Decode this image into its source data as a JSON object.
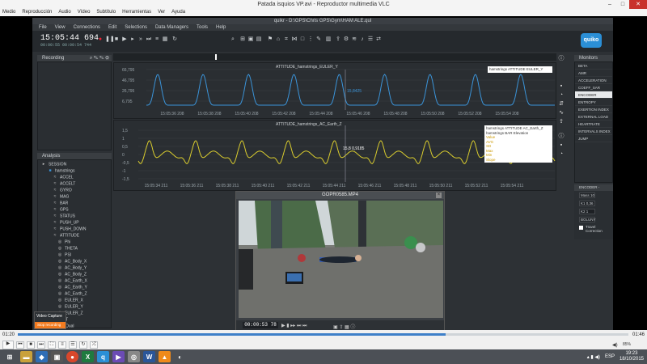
{
  "vlc": {
    "title": "Patada isquios VP.avi - Reproductor multimedia VLC",
    "menu": [
      "Medio",
      "Reproducción",
      "Audio",
      "Vídeo",
      "Subtítulo",
      "Herramientas",
      "Ver",
      "Ayuda"
    ],
    "time_elapsed": "01:20",
    "time_total": "01:46",
    "progress_fraction": 0.7,
    "volume": "85%"
  },
  "taskbar": {
    "clock_time": "19:23",
    "clock_date": "18/10/2015",
    "lang": "ESP"
  },
  "app": {
    "title": "quikr - D:\\GPS\\Chris GPS\\Gym\\HAM ALE.qul",
    "menu": [
      "File",
      "View",
      "Connections",
      "Edit",
      "Selections",
      "Data Managers",
      "Tools",
      "Help"
    ],
    "clock": "15:05:44 694",
    "clock_sub_a": "00:00:55",
    "clock_sub_b": "00:00:54 744",
    "logo": "quiko",
    "recording_label": "Recording",
    "analysis_label": "Analysis",
    "tree": [
      "SESSION",
      "hamstrings",
      "ACCEL",
      "ACCELT",
      "GYRO",
      "MAG",
      "BAR",
      "GPS",
      "STATUS",
      "PUSH_UP",
      "PUSH_DOWN",
      "ATTITUDE",
      "Phi",
      "THETA",
      "PSI",
      "AC_Body_X",
      "AC_Body_Y",
      "AC_Body_Z",
      "AC_Earth_X",
      "AC_Earth_Y",
      "AC_Earth_Z",
      "EULER_X",
      "EULER_Y",
      "EULER_Z",
      "HRT",
      "REQual"
    ],
    "monitors_label": "Monitors",
    "monitors": [
      "BETA",
      "AMR",
      "ACCELERATION",
      "COEFF_SAR",
      "ENCODER",
      "ENTROPY",
      "EXERTION INDEX",
      "EXTERNAL LOAD",
      "HEARTRATE",
      "INTERVALS INDEX",
      "JUMP"
    ],
    "encoder_label": "ENCODER - ATTITUDE_N",
    "encoder_fields": [
      "Mass 10",
      "K1 0,36",
      "K2 1",
      "BOLUNY"
    ],
    "travel_correction": "Travel Correction"
  },
  "chart_data": [
    {
      "type": "line",
      "title": "ATTITUDE_hamstrings_EULER_Y",
      "y_ticks": [
        "66,795",
        "46,795",
        "26,795",
        "6,795"
      ],
      "x_ticks": [
        "15:05:36 208",
        "15:05:38 208",
        "15:05:40 208",
        "15:05:42 208",
        "15:05:44 208",
        "15:05:46 208",
        "15:05:48 208",
        "15:05:50 208",
        "15:05:52 208",
        "15:05:54 208"
      ],
      "series": [
        {
          "name": "hamstrings ATTITUDE EULER_Y",
          "color": "#3b94d9"
        }
      ],
      "marker_label": "15,8425"
    },
    {
      "type": "line",
      "title": "ATTITUDE_hamstrings_AC_Earth_Z",
      "y_ticks": [
        "1,5",
        "1",
        "0,5",
        "0",
        "-0,5",
        "-1",
        "-1,5"
      ],
      "x_ticks": [
        "15:05:34 211",
        "15:05:36 211",
        "15:05:38 211",
        "15:05:40 211",
        "15:05:42 211",
        "15:05:44 211",
        "15:05:46 211",
        "15:05:48 211",
        "15:05:50 211",
        "15:05:52 211",
        "15:05:54 211"
      ],
      "series": [
        {
          "name": "hamstrings ATTITUDE AC_Earth_Z",
          "color": "#d9cc2e"
        }
      ],
      "legend": [
        "hamstrings ATTITUDE AC_Earth_Z",
        "hamstrings BAR Elevation",
        "Value",
        "AVG",
        "SD",
        "Max",
        "Min",
        "Slope"
      ],
      "marker_label": "15,8 0,9185"
    }
  ],
  "video": {
    "title": "GOPR0585.MP4",
    "time": "00:00:53 78"
  },
  "popup": {
    "title": "Video Capture",
    "button": "Stop recording"
  }
}
